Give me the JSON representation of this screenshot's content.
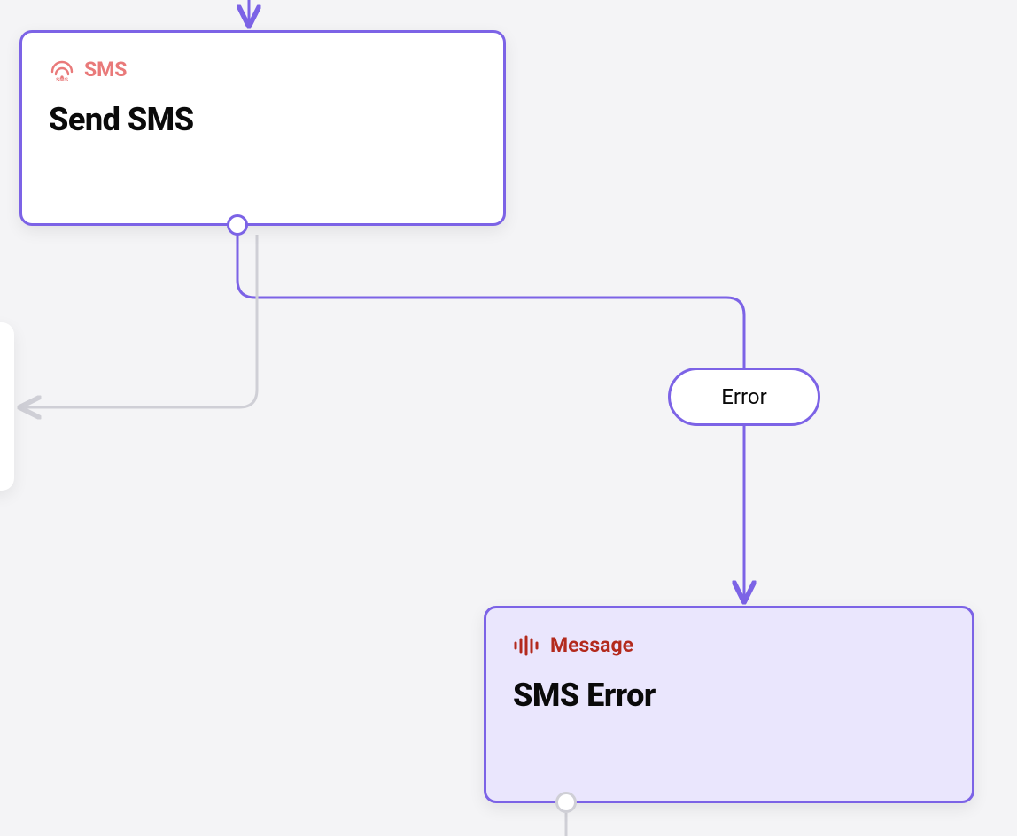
{
  "nodes": {
    "send_sms": {
      "type_label": "SMS",
      "title": "Send SMS"
    },
    "sms_error": {
      "type_label": "Message",
      "title": "SMS Error"
    }
  },
  "edges": {
    "error_label": "Error"
  },
  "colors": {
    "accent": "#7c63e6",
    "sms_type": "#e97a7a",
    "message_type": "#b32a1d",
    "edge_gray": "#cfcfd6",
    "page_bg": "#f4f4f6",
    "node_white": "#ffffff",
    "node_tint": "#eae6fd"
  }
}
